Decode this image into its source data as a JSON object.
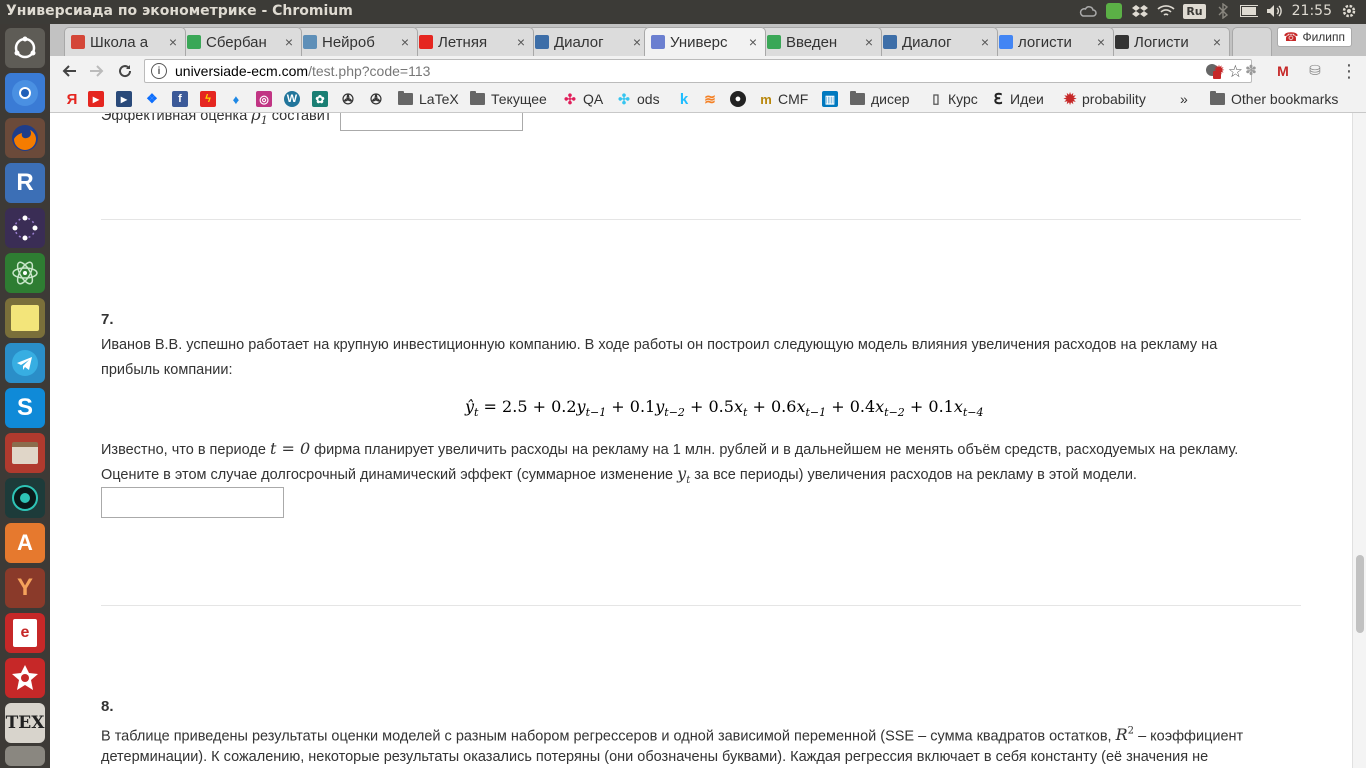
{
  "window": {
    "title": "Универсиада по эконометрике - Chromium",
    "clock": "21:55",
    "keyboard_layout": "Ru"
  },
  "tabs": [
    {
      "label": "Школа а",
      "favicon": "gmail-icon",
      "color": "#d44638"
    },
    {
      "label": "Сбербан",
      "favicon": "chat-icon",
      "color": "#3aa757"
    },
    {
      "label": "Нейроб",
      "favicon": "h-icon",
      "color": "#5e8fb8"
    },
    {
      "label": "Летняя",
      "favicon": "yandex-icon",
      "color": "#e52620"
    },
    {
      "label": "Диалог",
      "favicon": "dialog-icon",
      "color": "#3d6ea8"
    },
    {
      "label": "Универс",
      "favicon": "universiade-icon",
      "color": "#6b7fd0",
      "active": true
    },
    {
      "label": "Введен",
      "favicon": "coursera-icon",
      "color": "#3aa757"
    },
    {
      "label": "Диалог",
      "favicon": "dialog-icon",
      "color": "#3d6ea8"
    },
    {
      "label": "логисти",
      "favicon": "google-icon",
      "color": "#4285f4"
    },
    {
      "label": "Логисти",
      "favicon": "wikipedia-icon",
      "color": "#333333"
    }
  ],
  "profile_label": "Филипп",
  "toolbar": {
    "url_domain": "universiade-ecm.com",
    "url_path": "/test.php?code=113"
  },
  "bookmarks": [
    {
      "label": "LaTeX",
      "type": "folder"
    },
    {
      "label": "Текущее",
      "type": "folder"
    },
    {
      "label": "QA",
      "type": "slack"
    },
    {
      "label": "ods",
      "type": "slack"
    },
    {
      "label": "CMF",
      "type": "cmf"
    },
    {
      "label": "дисер",
      "type": "folder"
    },
    {
      "label": "Курс",
      "type": "page"
    },
    {
      "label": "Идеи",
      "type": "evernote"
    },
    {
      "label": "probability",
      "type": "gear"
    },
    {
      "label": "»",
      "type": "overflow"
    },
    {
      "label": "Other bookmarks",
      "type": "folder"
    }
  ],
  "content": {
    "prev_question_tail": "Эффективная оценка",
    "prev_question_tail_after": "составит",
    "q7": {
      "number": "7.",
      "line1": "Иванов В.В. успешно работает на крупную инвестиционную компанию. В ходе работы он построил следующую модель влияния увеличения расходов на рекламу на",
      "line2": "прибыль компании:",
      "line3a": "Известно, что в периоде",
      "line3b": "фирма планирует увеличить расходы на рекламу на 1 млн. рублей и в дальнейшем не менять объём средств, расходуемых на рекламу.",
      "line4a": "Оцените в этом случае долгосрочный динамический эффект (суммарное изменение",
      "line4b": "за все периоды) увеличения расходов на рекламу в этой модели."
    },
    "q8": {
      "number": "8.",
      "line1a": "В таблице приведены результаты оценки моделей с разным набором регрессеров и одной зависимой переменной (SSE – сумма квадратов остатков,",
      "line1b": "– коэффициент",
      "line2": "детерминации). К сожалению, некоторые результаты оказались потеряны (они обозначены буквами). Каждая регрессия включает в себя константу (её значения не"
    }
  }
}
